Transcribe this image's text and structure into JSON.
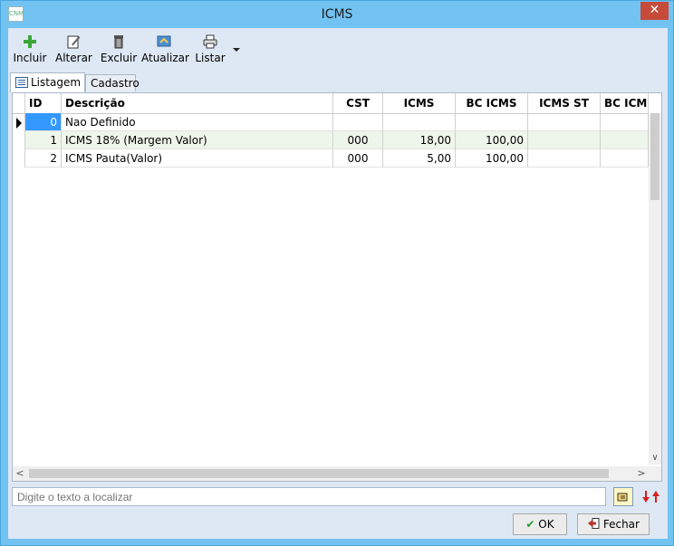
{
  "window": {
    "title": "ICMS",
    "close_glyph": "✕",
    "app_icon": "app-logo-icon",
    "app_icon_text": "CNM"
  },
  "toolbar": {
    "buttons": [
      {
        "label": "Incluir",
        "icon": "plus-icon"
      },
      {
        "label": "Alterar",
        "icon": "edit-icon"
      },
      {
        "label": "Excluir",
        "icon": "trash-icon"
      },
      {
        "label": "Atualizar",
        "icon": "refresh-icon"
      },
      {
        "label": "Listar",
        "icon": "printer-icon"
      }
    ]
  },
  "tabs": [
    {
      "label": "Listagem",
      "icon": "list-icon",
      "active": true
    },
    {
      "label": "Cadastro",
      "active": false
    }
  ],
  "grid": {
    "columns": [
      "ID",
      "Descrição",
      "CST",
      "ICMS",
      "BC ICMS",
      "ICMS ST",
      "BC ICMS"
    ],
    "rows": [
      {
        "id": "0",
        "descricao": "Nao Definido",
        "cst": "",
        "icms": "",
        "bc_icms": "",
        "icms_st": "",
        "bc_icms_st": "",
        "selected": true
      },
      {
        "id": "1",
        "descricao": "ICMS 18% (Margem Valor)",
        "cst": "000",
        "icms": "18,00",
        "bc_icms": "100,00",
        "icms_st": "",
        "bc_icms_st": ""
      },
      {
        "id": "2",
        "descricao": "ICMS Pauta(Valor)",
        "cst": "000",
        "icms": "5,00",
        "bc_icms": "100,00",
        "icms_st": "",
        "bc_icms_st": ""
      }
    ]
  },
  "search": {
    "placeholder": "Digite o texto a localizar"
  },
  "buttons": {
    "ok": "OK",
    "fechar": "Fechar"
  },
  "colors": {
    "titlebar": "#72c2f2",
    "selected_cell": "#3399ff",
    "alt_row": "#eef5ea",
    "close": "#c74b3b"
  }
}
